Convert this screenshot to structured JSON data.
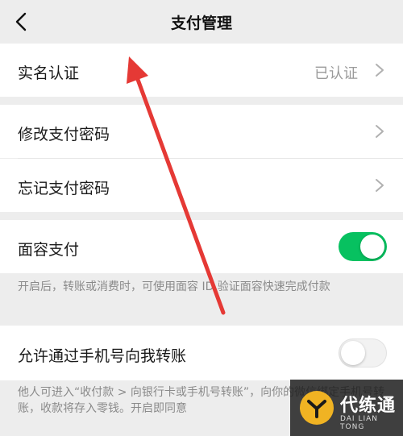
{
  "header": {
    "title": "支付管理"
  },
  "sections": {
    "realname": {
      "label": "实名认证",
      "value": "已认证"
    },
    "change_password": {
      "label": "修改支付密码"
    },
    "forgot_password": {
      "label": "忘记支付密码"
    },
    "face_pay": {
      "label": "面容支付",
      "enabled": true,
      "note": "开启后，转账或消费时，可使用面容 ID 验证面容快速完成付款"
    },
    "phone_transfer": {
      "label": "允许通过手机号向我转账",
      "enabled": false,
      "note": "他人可进入“收付款 > 向银行卡或手机号转账”，向你的微信绑定手机号转账，收款将存入零钱。开启即同意"
    }
  },
  "watermark": {
    "brand": "代练通",
    "sub": "DAI LIAN TONG"
  },
  "colors": {
    "accent": "#07c160",
    "annotation_arrow": "#e53935"
  }
}
